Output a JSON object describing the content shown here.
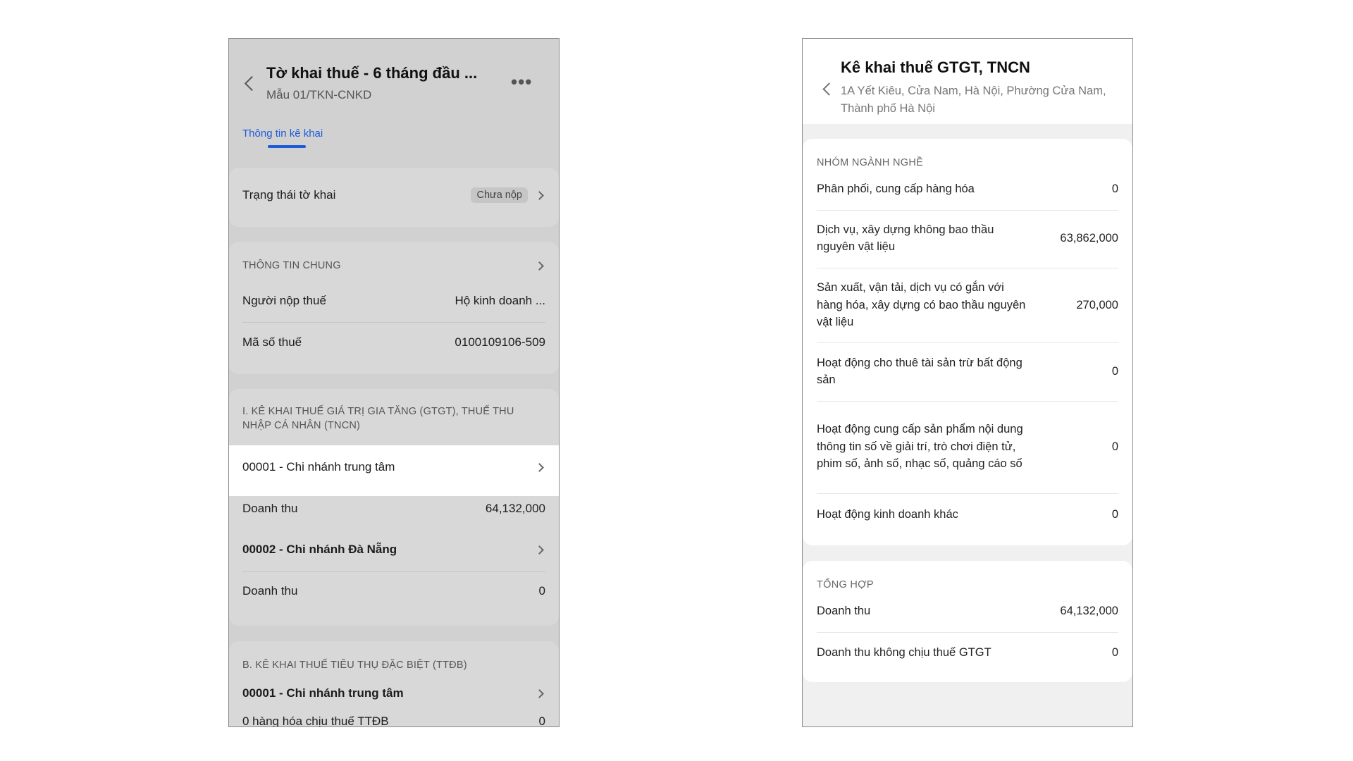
{
  "left": {
    "title": "Tờ khai thuế - 6 tháng đầu ...",
    "subtitle": "Mẫu 01/TKN-CNKD",
    "tab_active": "Thông tin kê khai",
    "status": {
      "label": "Trạng thái tờ khai",
      "badge": "Chưa nộp"
    },
    "general": {
      "heading": "THÔNG TIN CHUNG",
      "rows": [
        {
          "label": "Người nộp thuế",
          "value": "Hộ kinh doanh ..."
        },
        {
          "label": "Mã số thuế",
          "value": "0100109106-509"
        }
      ]
    },
    "vat_section": {
      "heading": "I. KÊ KHAI THUẾ GIÁ TRỊ GIA TĂNG (GTGT), THUẾ THU NHẬP CÁ NHÂN (TNCN)",
      "branch1": "00001 - Chi nhánh trung tâm",
      "rev1_label": "Doanh thu",
      "rev1_value": "64,132,000",
      "branch2": "00002 - Chi nhánh Đà Nẵng",
      "rev2_label": "Doanh thu",
      "rev2_value": "0"
    },
    "ttdb_section": {
      "heading": "B. KÊ KHAI THUẾ TIÊU THỤ ĐẶC BIỆT (TTĐB)",
      "branch1": "00001 - Chi nhánh trung tâm",
      "partial_label": "0 hàng hóa chịu thuế TTĐB",
      "partial_value": "0"
    }
  },
  "right": {
    "title": "Kê khai thuế GTGT, TNCN",
    "address": "1A Yết Kiêu, Cửa Nam, Hà Nội, Phường Cửa Nam, Thành phố Hà Nội",
    "industry": {
      "heading": "NHÓM NGÀNH NGHỀ",
      "rows": [
        {
          "label": "Phân phối, cung cấp hàng hóa",
          "value": "0"
        },
        {
          "label": "Dịch vụ, xây dựng không bao thầu nguyên vật liệu",
          "value": "63,862,000"
        },
        {
          "label": "Sản xuất, vận tải, dịch vụ có gắn với hàng hóa, xây dựng có bao thầu nguyên vật liệu",
          "value": "270,000"
        },
        {
          "label": "Hoạt động cho thuê tài sản trừ bất động sản",
          "value": "0"
        },
        {
          "label": "Hoạt động cung cấp sản phẩm nội dung thông tin số về giải trí, trò chơi điện tử, phim số, ảnh số, nhạc số, quảng cáo số",
          "value": "0"
        },
        {
          "label": "Hoạt động kinh doanh khác",
          "value": "0"
        }
      ]
    },
    "summary": {
      "heading": "TỔNG HỢP",
      "rows": [
        {
          "label": "Doanh thu",
          "value": "64,132,000"
        },
        {
          "label": "Doanh thu không chịu thuế GTGT",
          "value": "0"
        }
      ]
    }
  }
}
